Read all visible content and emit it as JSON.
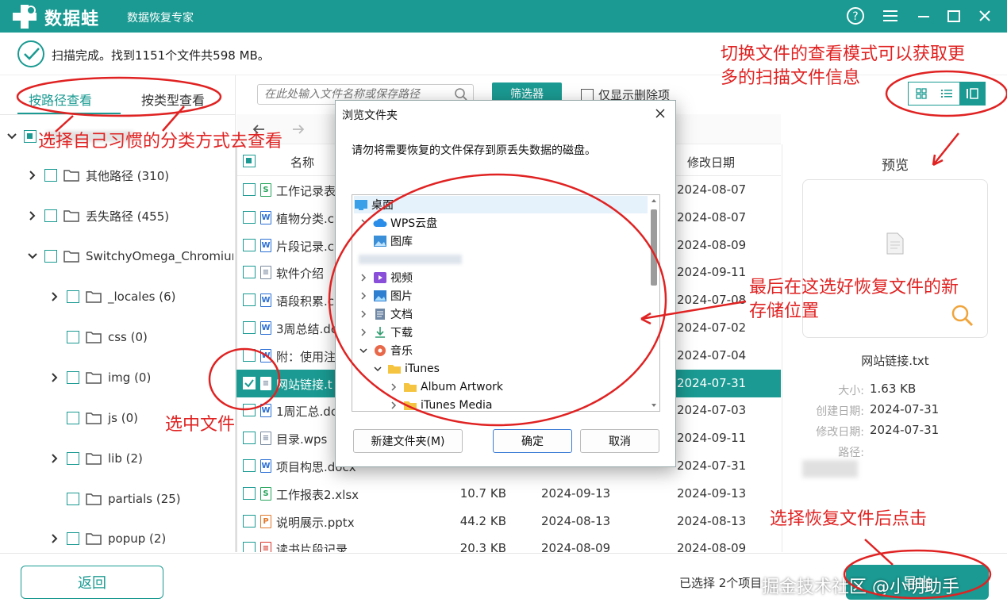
{
  "app": {
    "brand": "数据蛙",
    "subtitle": "数据恢复专家",
    "colors": {
      "accent": "#1a9a92",
      "annotation": "#e02222"
    },
    "window_buttons": [
      "help-icon",
      "menu-icon",
      "minimize-icon",
      "maximize-icon",
      "close-icon"
    ]
  },
  "status": {
    "text": "扫描完成。找到1151个文件共598 MB。"
  },
  "left_panel": {
    "tabs": [
      {
        "label": "按路径查看",
        "active": true
      },
      {
        "label": "按类型查看",
        "active": false
      }
    ],
    "tree": [
      {
        "label": "其他路径 (310)"
      },
      {
        "label": "丢失路径 (455)"
      },
      {
        "label": "SwitchyOmega_Chromium"
      },
      {
        "label": "_locales (6)"
      },
      {
        "label": "css (0)"
      },
      {
        "label": "img (0)"
      },
      {
        "label": "js (0)"
      },
      {
        "label": "lib (2)"
      },
      {
        "label": "partials (25)"
      },
      {
        "label": "popup (2)"
      }
    ]
  },
  "toolbar": {
    "search_placeholder": "在此处输入文件名称或保存路径",
    "filter_label": "筛选器",
    "only_deleted_label": "仅显示删除项"
  },
  "file_table": {
    "headers": {
      "name": "名称",
      "modified": "修改日期"
    },
    "rows": [
      {
        "name": "工作记录表",
        "size": "",
        "date1": "",
        "date2": "2024-08-07",
        "type": "xlsx",
        "checked": false
      },
      {
        "name": "植物分类.c",
        "size": "",
        "date1": "",
        "date2": "2024-08-07",
        "type": "docx",
        "checked": false
      },
      {
        "name": "片段记录.c",
        "size": "",
        "date1": "",
        "date2": "2024-08-09",
        "type": "docx",
        "checked": false
      },
      {
        "name": "软件介绍",
        "size": "",
        "date1": "",
        "date2": "2024-09-11",
        "type": "wps",
        "checked": false
      },
      {
        "name": "语段积累.c",
        "size": "",
        "date1": "",
        "date2": "2024-07-08",
        "type": "docx",
        "checked": false
      },
      {
        "name": "3周总结.dc",
        "size": "",
        "date1": "",
        "date2": "2024-07-02",
        "type": "docx",
        "checked": false
      },
      {
        "name": "附：使用注",
        "size": "",
        "date1": "",
        "date2": "2024-07-04",
        "type": "docx",
        "checked": false
      },
      {
        "name": "网站链接.t",
        "size": "",
        "date1": "",
        "date2": "2024-07-31",
        "type": "txt",
        "checked": true
      },
      {
        "name": "1周汇总.dc",
        "size": "",
        "date1": "",
        "date2": "2024-07-03",
        "type": "docx",
        "checked": false
      },
      {
        "name": "目录.wps",
        "size": "",
        "date1": "",
        "date2": "2024-09-11",
        "type": "wps",
        "checked": false
      },
      {
        "name": "项目构思.docx",
        "size": "",
        "date1": "",
        "date2": "2024-07-31",
        "type": "docx",
        "checked": false
      },
      {
        "name": "工作报表2.xlsx",
        "size": "10.7 KB",
        "date1": "2024-09-13",
        "date2": "2024-09-13",
        "type": "xlsx",
        "checked": false
      },
      {
        "name": "说明展示.pptx",
        "size": "44.2 KB",
        "date1": "2024-08-13",
        "date2": "2024-08-13",
        "type": "pptx",
        "checked": false
      },
      {
        "name": "读书片段记录....",
        "size": "20.3 KB",
        "date1": "2024-08-09",
        "date2": "2024-08-09",
        "type": "pdf",
        "checked": false
      }
    ]
  },
  "preview": {
    "title": "预览",
    "file_name": "网站链接.txt",
    "size_label": "大小:",
    "size": "1.63 KB",
    "created_label": "创建日期:",
    "created": "2024-07-31",
    "modified_label": "修改日期:",
    "modified": "2024-07-31",
    "path_label": "路径:"
  },
  "bottom": {
    "back_label": "返回",
    "selected_info": "已选择 2个项目",
    "recover_label": "导出"
  },
  "dialog": {
    "title": "浏览文件夹",
    "description": "请勿将需要恢复的文件保存到原丢失数据的磁盘。",
    "tree": [
      {
        "label": "桌面",
        "icon": "desktop-icon"
      },
      {
        "label": "WPS云盘",
        "icon": "cloud-icon"
      },
      {
        "label": "图库",
        "icon": "gallery-icon"
      },
      {
        "label": "视频",
        "icon": "video-icon"
      },
      {
        "label": "图片",
        "icon": "picture-icon"
      },
      {
        "label": "文档",
        "icon": "document-icon"
      },
      {
        "label": "下载",
        "icon": "download-icon"
      },
      {
        "label": "音乐",
        "icon": "music-icon"
      },
      {
        "label": "iTunes",
        "icon": "folder-icon"
      },
      {
        "label": "Album Artwork",
        "icon": "folder-icon"
      },
      {
        "label": "iTunes Media",
        "icon": "folder-icon"
      }
    ],
    "new_folder_label": "新建文件夹(M)",
    "ok_label": "确定",
    "cancel_label": "取消"
  },
  "annotations": {
    "view_mode": "切换文件的查看模式可以获取更多的扫描文件信息",
    "view_mode_line1": "切换文件的查看模式可以获取更",
    "view_mode_line2": "多的扫描文件信息",
    "classify": "选择自己习惯的分类方式去查看",
    "select_file": "选中文件",
    "location_line1": "最后在这选好恢复文件的新",
    "location_line2": "存储位置",
    "click_after": "选择恢复文件后点击"
  },
  "watermark": "掘金技术社区 @小明助手"
}
